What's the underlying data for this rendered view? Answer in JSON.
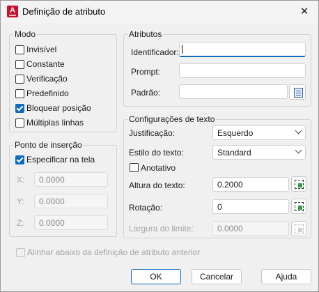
{
  "window": {
    "title": "Definição de atributo"
  },
  "modo": {
    "label": "Modo",
    "items": [
      {
        "label": "Invisível",
        "checked": false
      },
      {
        "label": "Constante",
        "checked": false
      },
      {
        "label": "Verificação",
        "checked": false
      },
      {
        "label": "Predefinido",
        "checked": false
      },
      {
        "label": "Bloquear posição",
        "checked": true
      },
      {
        "label": "Múltiplas linhas",
        "checked": false
      }
    ]
  },
  "ponto": {
    "label": "Ponto de inserção",
    "specify_label": "Especificar na tela",
    "x_label": "X:",
    "x_value": "0.0000",
    "y_label": "Y:",
    "y_value": "0.0000",
    "z_label": "Z:",
    "z_value": "0.0000"
  },
  "atributos": {
    "label": "Atributos",
    "identificador_label": "Identificador:",
    "identificador_value": "",
    "prompt_label": "Prompt:",
    "prompt_value": "",
    "padrao_label": "Padrão:",
    "padrao_value": ""
  },
  "texto": {
    "label": "Configurações de texto",
    "justificacao_label": "Justificação:",
    "justificacao_value": "Esquerdo",
    "estilo_label": "Estilo do texto:",
    "estilo_value": "Standard",
    "anotativo_label": "Anotativo",
    "altura_label": "Altura do texto:",
    "altura_value": "0.2000",
    "rotacao_label": "Rotação:",
    "rotacao_value": "0",
    "largura_label": "Largura do limite:",
    "largura_value": "0.0000"
  },
  "alinhar_label": "Alinhar abaixo da definição de atributo anterior",
  "buttons": {
    "ok": "OK",
    "cancelar": "Cancelar",
    "ajuda": "Ajuda"
  },
  "colors": {
    "accent": "#0f6cbd",
    "app_icon": "#c8102e"
  }
}
